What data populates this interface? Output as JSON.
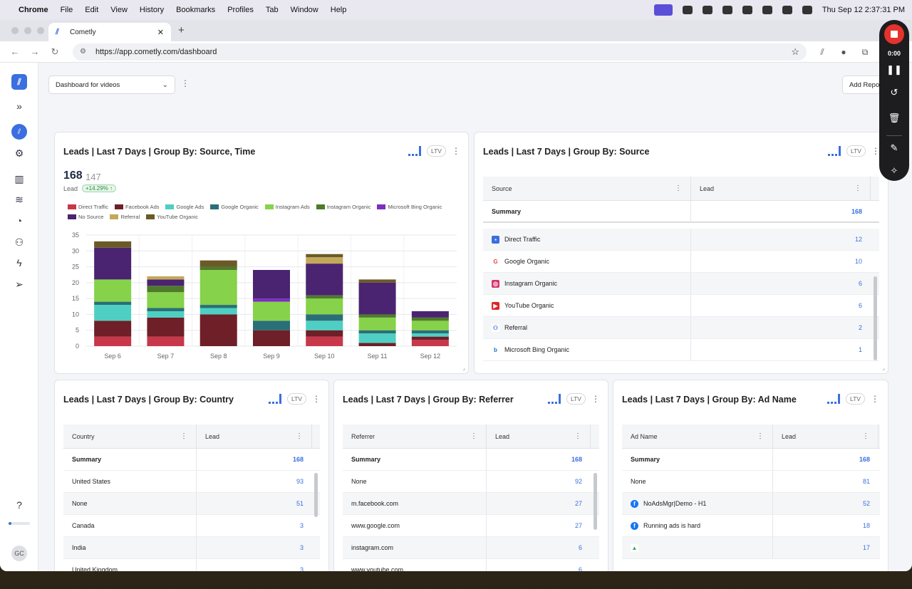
{
  "menubar": {
    "app": "Chrome",
    "items": [
      "File",
      "Edit",
      "View",
      "History",
      "Bookmarks",
      "Profiles",
      "Tab",
      "Window",
      "Help"
    ],
    "clock": "Thu Sep 12  2:37:31 PM"
  },
  "browser": {
    "tab_title": "Cometly",
    "url": "https://app.cometly.com/dashboard"
  },
  "toolbar": {
    "dashboard_select": "Dashboard for videos",
    "add_report": "Add Repo"
  },
  "recorder": {
    "time": "0:00"
  },
  "sidebar": {
    "avatar": "GC"
  },
  "cards": {
    "source_time": {
      "title": "Leads | Last 7 Days | Group By: Source, Time",
      "ltv": "LTV",
      "value": "168",
      "previous": "147",
      "metric": "Lead",
      "delta": "+14.29% ↑"
    },
    "source": {
      "title": "Leads | Last 7 Days | Group By: Source",
      "ltv": "LTV",
      "col1": "Source",
      "col2": "Lead",
      "summary_label": "Summary",
      "summary_value": "168",
      "rows": [
        {
          "label": "Direct Traffic",
          "value": "12",
          "icon": "chat-icon",
          "color": "#3b6fe0"
        },
        {
          "label": "Google Organic",
          "value": "10",
          "icon": "google-icon",
          "color": "#ea4335"
        },
        {
          "label": "Instagram Organic",
          "value": "6",
          "icon": "instagram-icon",
          "color": "#d6336c"
        },
        {
          "label": "YouTube Organic",
          "value": "6",
          "icon": "youtube-icon",
          "color": "#e02424"
        },
        {
          "label": "Referral",
          "value": "2",
          "icon": "users-icon",
          "color": "#3b6fe0"
        },
        {
          "label": "Microsoft Bing Organic",
          "value": "1",
          "icon": "bing-icon",
          "color": "#1a73c8"
        }
      ]
    },
    "country": {
      "title": "Leads | Last 7 Days | Group By: Country",
      "ltv": "LTV",
      "col1": "Country",
      "col2": "Lead",
      "summary_label": "Summary",
      "summary_value": "168",
      "rows": [
        {
          "label": "United States",
          "value": "93"
        },
        {
          "label": "None",
          "value": "51"
        },
        {
          "label": "Canada",
          "value": "3"
        },
        {
          "label": "India",
          "value": "3"
        },
        {
          "label": "United Kingdom",
          "value": "3"
        }
      ]
    },
    "referrer": {
      "title": "Leads | Last 7 Days | Group By: Referrer",
      "ltv": "LTV",
      "col1": "Referrer",
      "col2": "Lead",
      "summary_label": "Summary",
      "summary_value": "168",
      "rows": [
        {
          "label": "None",
          "value": "92"
        },
        {
          "label": "m.facebook.com",
          "value": "27"
        },
        {
          "label": "www.google.com",
          "value": "27"
        },
        {
          "label": "instagram.com",
          "value": "6"
        },
        {
          "label": "www.youtube.com",
          "value": "6"
        }
      ]
    },
    "adname": {
      "title": "Leads | Last 7 Days | Group By: Ad Name",
      "ltv": "LTV",
      "col1": "Ad Name",
      "col2": "Lead",
      "summary_label": "Summary",
      "summary_value": "168",
      "rows": [
        {
          "label": "None",
          "value": "81",
          "icon": ""
        },
        {
          "label": "NoAdsMgr|Demo - H1",
          "value": "52",
          "icon": "facebook-icon"
        },
        {
          "label": "Running ads is hard",
          "value": "18",
          "icon": "facebook-icon"
        },
        {
          "label": "",
          "value": "17",
          "icon": "google-ads-icon"
        }
      ]
    }
  },
  "chart_data": {
    "type": "bar",
    "stacked": true,
    "categories": [
      "Sep 6",
      "Sep 7",
      "Sep 8",
      "Sep 9",
      "Sep 10",
      "Sep 11",
      "Sep 12"
    ],
    "ylim": [
      0,
      35
    ],
    "yticks": [
      0,
      5,
      10,
      15,
      20,
      25,
      30,
      35
    ],
    "grid": true,
    "legend_position": "top-left",
    "series": [
      {
        "name": "Direct Traffic",
        "color": "#c8374a",
        "values": [
          3,
          3,
          0,
          0,
          3,
          0,
          2
        ]
      },
      {
        "name": "Facebook Ads",
        "color": "#6e1f27",
        "values": [
          5,
          6,
          10,
          5,
          2,
          1,
          1
        ]
      },
      {
        "name": "Google Ads",
        "color": "#4fcfc3",
        "values": [
          5,
          2,
          2,
          0,
          3,
          3,
          1
        ]
      },
      {
        "name": "Google Organic",
        "color": "#2a6f78",
        "values": [
          1,
          1,
          1,
          3,
          2,
          1,
          1
        ]
      },
      {
        "name": "Instagram Ads",
        "color": "#86d24a",
        "values": [
          7,
          5,
          11,
          6,
          5,
          4,
          3
        ]
      },
      {
        "name": "Instagram Organic",
        "color": "#4f7a2c",
        "values": [
          0,
          2,
          1,
          0,
          1,
          1,
          1
        ]
      },
      {
        "name": "Microsoft Bing Organic",
        "color": "#7b2fbf",
        "values": [
          0,
          0,
          0,
          1,
          0,
          0,
          0
        ]
      },
      {
        "name": "No Source",
        "color": "#4a2470",
        "values": [
          10,
          2,
          0,
          9,
          10,
          10,
          2
        ]
      },
      {
        "name": "Referral",
        "color": "#c4a85a",
        "values": [
          0,
          1,
          0,
          0,
          2,
          0,
          0
        ]
      },
      {
        "name": "YouTube Organic",
        "color": "#6b5a28",
        "values": [
          2,
          0,
          2,
          0,
          1,
          1,
          0
        ]
      }
    ]
  }
}
